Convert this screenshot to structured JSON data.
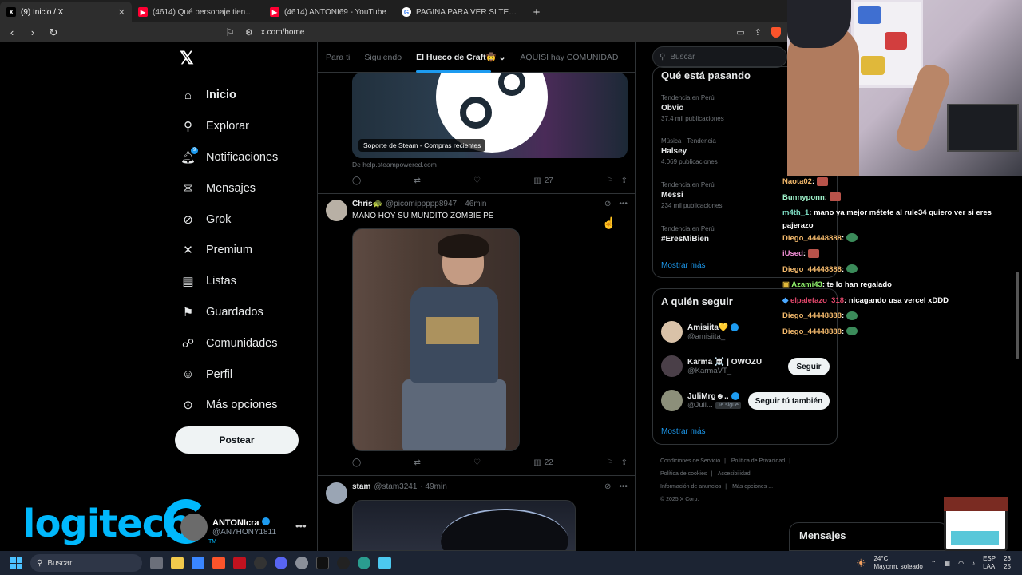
{
  "browser": {
    "tabs": [
      {
        "title": "(9) Inicio / X",
        "active": true,
        "favicon": "x-favicon"
      },
      {
        "title": "(4614) Qué personaje tiene más Rule",
        "active": false,
        "favicon": "youtube-favicon"
      },
      {
        "title": "(4614) ANTONI69 - YouTube",
        "active": false,
        "favicon": "youtube-favicon"
      },
      {
        "title": "PAGINA PARA VER SI TENGO BOTS E",
        "active": false,
        "favicon": "google-favicon"
      }
    ],
    "url": "x.com/home"
  },
  "nav": {
    "items": [
      {
        "label": "Inicio",
        "icon": "home-icon",
        "glyph": "⌂",
        "bold": true
      },
      {
        "label": "Explorar",
        "icon": "search-icon",
        "glyph": "⚲"
      },
      {
        "label": "Notificaciones",
        "icon": "bell-icon",
        "glyph": "♫",
        "badge": "9"
      },
      {
        "label": "Mensajes",
        "icon": "mail-icon",
        "glyph": "✉"
      },
      {
        "label": "Grok",
        "icon": "grok-icon",
        "glyph": "⊘"
      },
      {
        "label": "Premium",
        "icon": "x-icon",
        "glyph": "✕"
      },
      {
        "label": "Listas",
        "icon": "list-icon",
        "glyph": "▤"
      },
      {
        "label": "Guardados",
        "icon": "bookmark-icon",
        "glyph": "⚑"
      },
      {
        "label": "Comunidades",
        "icon": "communities-icon",
        "glyph": "☍"
      },
      {
        "label": "Perfil",
        "icon": "person-icon",
        "glyph": "☺"
      },
      {
        "label": "Más opciones",
        "icon": "more-circle-icon",
        "glyph": "⊙"
      }
    ],
    "post_label": "Postear"
  },
  "profile": {
    "name": "ANTONIcra",
    "handle": "@AN7HONY1811"
  },
  "overlay": {
    "logitech": "logitech",
    "tm": "TM"
  },
  "feed": {
    "tabs": [
      "Para ti",
      "Siguiendo",
      "El Hueco de Craft🤠",
      "AQUISI hay COMUNIDAD"
    ],
    "tweet1": {
      "card_caption": "Soporte de Steam - Compras recientes",
      "source": "De help.steampowered.com",
      "views": "27"
    },
    "tweet2": {
      "name": "Chris🐢",
      "handle": "@picomippppp8947",
      "time": "· 46min",
      "text": "MANO HOY SU MUNDITO ZOMBIE PE",
      "views": "22"
    },
    "tweet3": {
      "name": "stam",
      "handle": "@stam3241",
      "time": "· 49min"
    }
  },
  "sidebar": {
    "search_placeholder": "Buscar",
    "trends_title": "Qué está pasando",
    "trends": [
      {
        "meta": "Tendencia en Perú",
        "name": "Obvio",
        "count": "37,4 mil publicaciones"
      },
      {
        "meta": "Música · Tendencia",
        "name": "Halsey",
        "count": "4.069 publicaciones"
      },
      {
        "meta": "Tendencia en Perú",
        "name": "Messi",
        "count": "234 mil publicaciones"
      },
      {
        "meta": "Tendencia en Perú",
        "name": "#EresMiBien",
        "count": ""
      }
    ],
    "show_more": "Mostrar más",
    "follow_title": "A quién seguir",
    "follow": [
      {
        "name": "Amisiita💛",
        "handle": "@amisiita_",
        "verified": true,
        "button": ""
      },
      {
        "name": "Karma ☠️ | OWOZU",
        "handle": "@KarmaVT_",
        "verified": false,
        "button": "Seguir"
      },
      {
        "name": "JuliMrg☻..",
        "handle": "@Juli...",
        "verified": true,
        "follows_you": "Te sigue",
        "button": "Seguir tú también"
      }
    ],
    "footer": [
      "Condiciones de Servicio",
      "|",
      "Política de Privacidad",
      "|",
      "Política de cookies",
      "|",
      "Accesibilidad",
      "|",
      "Información de anuncios",
      "|",
      "Más opciones ...",
      "© 2025 X Corp."
    ]
  },
  "chat": [
    {
      "user": "Naota02",
      "text": ":",
      "emote": "red",
      "color": "#f2b86b"
    },
    {
      "user": "Bunnyponn",
      "text": ":",
      "emote": "red",
      "color": "#9ef0c9"
    },
    {
      "user": "m4th_1",
      "text": ": mano ya mejor métete al rule34 quiero ver si eres",
      "color": "#7ee0c6"
    },
    {
      "user": "",
      "text": "pajerazo",
      "color": "#fff"
    },
    {
      "user": "Diego_44448888",
      "text": ":",
      "emote": "globe",
      "color": "#f2b86b"
    },
    {
      "user": "iUsed",
      "text": ":",
      "emote": "red",
      "color": "#f28fd6"
    },
    {
      "user": "Diego_44448888",
      "text": ":",
      "emote": "globe",
      "color": "#f2b86b"
    },
    {
      "user": "Azami43",
      "text": ": te lo han regalado",
      "color": "#8ff06b"
    },
    {
      "user": "elpaletazo_318",
      "text": ": nicagando usa vercel xDDD",
      "color": "#e0476a"
    },
    {
      "user": "Diego_44448888",
      "text": ":",
      "emote": "globe",
      "color": "#f2b86b"
    },
    {
      "user": "Diego_44448888",
      "text": ":",
      "emote": "globe",
      "color": "#f2b86b"
    }
  ],
  "messages_panel": "Mensajes",
  "taskbar": {
    "search": "Buscar",
    "weather_temp": "24°C",
    "weather_desc": "Mayorm. soleado",
    "lang": "ESP",
    "lang2": "LAA",
    "time": "23",
    "date": "25"
  }
}
